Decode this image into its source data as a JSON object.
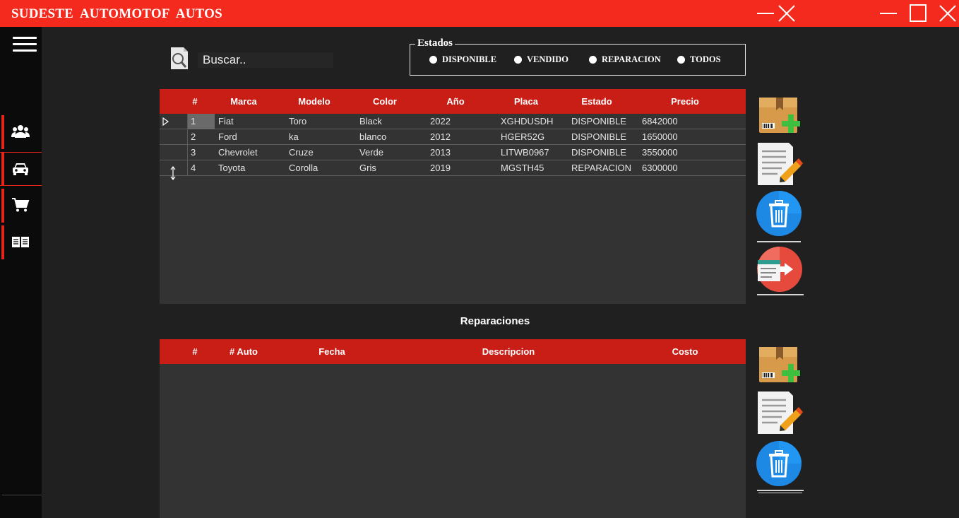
{
  "titlebar": {
    "title": "SUDESTE  AUTOMOTOF  AUTOS"
  },
  "sidebar": {
    "items": [
      {
        "icon": "users-icon",
        "label": "Clientes"
      },
      {
        "icon": "car-icon",
        "label": "Autos"
      },
      {
        "icon": "cart-icon",
        "label": "Ventas"
      },
      {
        "icon": "book-icon",
        "label": "Reportes"
      }
    ]
  },
  "search": {
    "placeholder": "Buscar.."
  },
  "estados": {
    "legend": "Estados",
    "options": [
      "DISPONIBLE",
      "VENDIDO",
      "REPARACION",
      "TODOS"
    ]
  },
  "autos_table": {
    "columns": [
      "#",
      "Marca",
      "Modelo",
      "Color",
      "Año",
      "Placa",
      "Estado",
      "Precio"
    ],
    "rows": [
      [
        "1",
        "Fiat",
        "Toro",
        "Black",
        "2022",
        "XGHDUSDH",
        "DISPONIBLE",
        "6842000"
      ],
      [
        "2",
        "Ford",
        "ka",
        "blanco",
        "2012",
        "HGER52G",
        "DISPONIBLE",
        "1650000"
      ],
      [
        "3",
        "Chevrolet",
        "Cruze",
        "Verde",
        "2013",
        "LITWB0967",
        "DISPONIBLE",
        "3550000"
      ],
      [
        "4",
        "Toyota",
        "Corolla",
        "Gris",
        "2019",
        "MGSTH45",
        "REPARACION",
        "6300000"
      ]
    ]
  },
  "reparaciones": {
    "title": "Reparaciones",
    "columns": [
      "#",
      "# Auto",
      "Fecha",
      "Descripcion",
      "Costo"
    ]
  },
  "colors": {
    "titlebar": "#f52a1e",
    "header": "#c81e16",
    "accent": "#e5251b"
  }
}
